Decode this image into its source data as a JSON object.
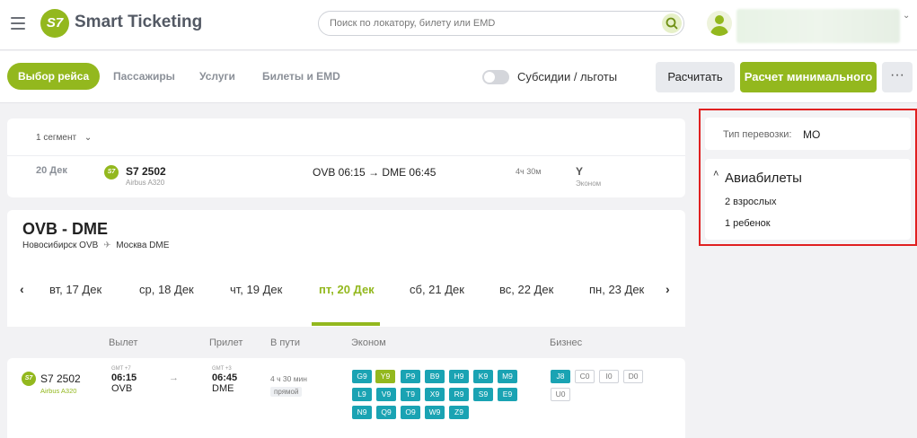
{
  "header": {
    "logo_mark": "S7",
    "app_title": "Smart Ticketing",
    "search_placeholder": "Поиск по локатору, билету или EMD"
  },
  "toolbar": {
    "tabs": [
      "Выбор рейса",
      "Пассажиры",
      "Услуги",
      "Билеты и EMD"
    ],
    "subsidy_label": "Субсидии / льготы",
    "calc_label": "Расчитать",
    "min_calc_label": "Расчет минимального",
    "more_label": "···"
  },
  "segment": {
    "count_label": "1 сегмент",
    "date": "20 Дек",
    "airline_mark": "S7",
    "flight": "S7 2502",
    "aircraft": "Airbus A320",
    "route_from": "OVB 06:15",
    "route_to": "DME 06:45",
    "duration": "4ч 30м",
    "class_code": "Y",
    "class_name": "Эконом"
  },
  "route": {
    "title": "OVB - DME",
    "from_city": "Новосибирск OVB",
    "to_city": "Москва DME"
  },
  "dates": [
    "вт, 17 Дек",
    "ср, 18 Дек",
    "чт, 19 Дек",
    "пт, 20 Дек",
    "сб, 21 Дек",
    "вс, 22 Дек",
    "пн, 23 Дек"
  ],
  "columns": {
    "departure": "Вылет",
    "arrival": "Прилет",
    "in_transit": "В пути",
    "economy": "Эконом",
    "business": "Бизнес"
  },
  "flight_row": {
    "airline_mark": "S7",
    "flight": "S7 2502",
    "aircraft": "Airbus A320",
    "dep_tz": "GMT +7",
    "dep_time": "06:15",
    "dep_airport": "OVB",
    "arr_tz": "GMT +3",
    "arr_time": "06:45",
    "arr_airport": "DME",
    "duration": "4 ч 30 мин",
    "direct": "прямой",
    "economy_fares": [
      "G9",
      "Y9",
      "P9",
      "B9",
      "H9",
      "K9",
      "M9",
      "L9",
      "V9",
      "T9",
      "X9",
      "R9",
      "S9",
      "E9",
      "N9",
      "Q9",
      "O9",
      "W9",
      "Z9"
    ],
    "business_fares": [
      "J8",
      "C0",
      "I0",
      "D0",
      "U0"
    ]
  },
  "side_panel": {
    "transport_type_label": "Тип перевозки:",
    "transport_type_value": "МО",
    "section_title": "Авиабилеты",
    "adults": "2 взрослых",
    "children": "1 ребенок"
  },
  "colors": {
    "brand": "#93b81e",
    "fare_available": "#1aa3b3",
    "highlight_border": "#e02020"
  }
}
